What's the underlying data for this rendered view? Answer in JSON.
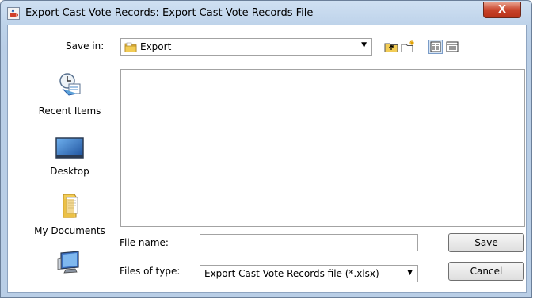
{
  "window": {
    "title": "Export Cast Vote Records: Export Cast Vote Records File",
    "close_label": "X"
  },
  "save_in": {
    "label": "Save in:",
    "value": "Export"
  },
  "toolbar_icons": [
    "up-one-level-icon",
    "create-new-folder-icon",
    "list-view-icon",
    "details-view-icon"
  ],
  "places": [
    {
      "label": "Recent Items",
      "icon": "recent-items-icon"
    },
    {
      "label": "Desktop",
      "icon": "desktop-icon"
    },
    {
      "label": "My Documents",
      "icon": "my-documents-icon"
    },
    {
      "label": "",
      "icon": "computer-icon"
    }
  ],
  "file_name": {
    "label": "File name:",
    "value": ""
  },
  "file_type": {
    "label": "Files of type:",
    "value": "Export Cast Vote Records file (*.xlsx)"
  },
  "buttons": {
    "save": "Save",
    "cancel": "Cancel"
  },
  "colors": {
    "frame": "#b9cee6",
    "close": "#c8442b",
    "folder": "#e8b83a"
  }
}
